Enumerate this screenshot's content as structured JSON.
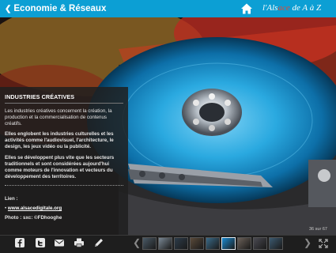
{
  "header": {
    "back_label": "Economie & Réseaux",
    "brand_prefix": "l'Als",
    "brand_accent": "ace",
    "brand_suffix": " de A à Z",
    "accent_color": "#0c9fd4"
  },
  "panel": {
    "title": "INDUSTRIES CRÉATIVES",
    "paragraph1": "Les industries créatives concernent la création, la production et la commercialisation de contenus créatifs.",
    "paragraph2": "Elles englobent les industries culturelles et les activités comme l'audiovisuel, l'architecture, le design, les jeux vidéo ou la publicité.",
    "paragraph3": "Elles se développent plus vite que les secteurs traditionnels et sont considérées aujourd'hui comme moteurs de l'innovation et vecteurs du développement des territoires.",
    "link_label": "Lien :",
    "link_bullet": "•",
    "link_text": "www.alsacedigitale.org",
    "photo_credit": "Photo : sxc: ©FDhooghe"
  },
  "gallery": {
    "counter": "36 sur 67",
    "thumbnail_count": 9,
    "active_index": 5
  },
  "icons": {
    "back": "chevron-left-icon",
    "home": "home-icon",
    "share": [
      "facebook-icon",
      "twitter-icon",
      "mail-icon",
      "print-icon",
      "pencil-icon"
    ],
    "expand": "fullscreen-icon"
  }
}
